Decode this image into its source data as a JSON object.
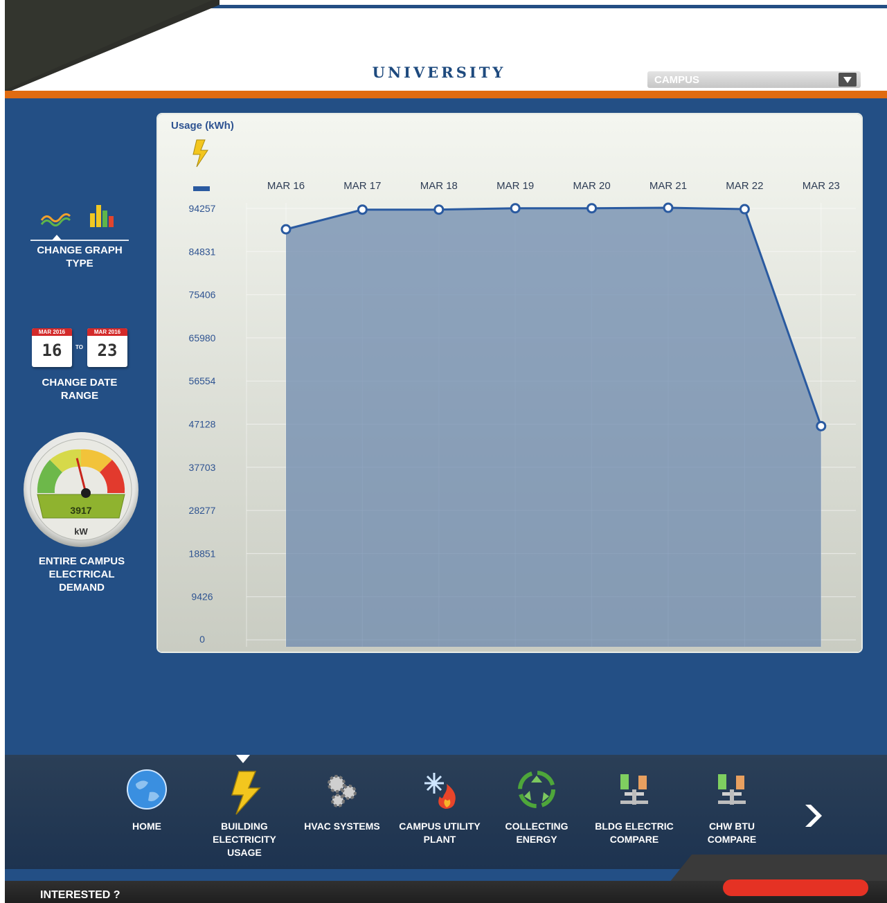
{
  "header": {
    "title": "UNIVERSITY",
    "selector_value": "CAMPUS"
  },
  "sidebar": {
    "graph_type_label_1": "CHANGE GRAPH",
    "graph_type_label_2": "TYPE",
    "date_from_month": "MAR 2016",
    "date_from_day": "16",
    "date_to_word": "TO",
    "date_to_month": "MAR 2016",
    "date_to_day": "23",
    "date_label_1": "CHANGE DATE",
    "date_label_2": "RANGE",
    "gauge_value": "3917",
    "gauge_unit": "kW",
    "gauge_level": 0.42,
    "demand_label_1": "ENTIRE CAMPUS",
    "demand_label_2": "ELECTRICAL",
    "demand_label_3": "DEMAND"
  },
  "chart_data": {
    "type": "area",
    "title": "Usage (kWh)",
    "categories": [
      "MAR 16",
      "MAR 17",
      "MAR 18",
      "MAR 19",
      "MAR 20",
      "MAR 21",
      "MAR 22",
      "MAR 23"
    ],
    "values": [
      89700,
      94000,
      94000,
      94300,
      94300,
      94400,
      94100,
      46700
    ],
    "ylim": [
      0,
      94257
    ],
    "yticks": [
      0,
      9426,
      18851,
      28277,
      37703,
      47128,
      56554,
      65980,
      75406,
      84831,
      94257
    ],
    "colors": {
      "line": "#2a5aa0",
      "fill": "#6e8aae",
      "marker": "#ffffff"
    },
    "grid": true
  },
  "nav": {
    "items": [
      {
        "label_1": "HOME",
        "label_2": "",
        "label_3": ""
      },
      {
        "label_1": "BUILDING",
        "label_2": "ELECTRICITY",
        "label_3": "USAGE"
      },
      {
        "label_1": "HVAC SYSTEMS",
        "label_2": "",
        "label_3": ""
      },
      {
        "label_1": "CAMPUS UTILITY",
        "label_2": "PLANT",
        "label_3": ""
      },
      {
        "label_1": "COLLECTING",
        "label_2": "ENERGY",
        "label_3": ""
      },
      {
        "label_1": "BLDG ELECTRIC",
        "label_2": "COMPARE",
        "label_3": ""
      },
      {
        "label_1": "CHW BTU",
        "label_2": "COMPARE",
        "label_3": ""
      }
    ],
    "active_index": 1,
    "icons": [
      "globe-icon",
      "lightning-icon",
      "gears-icon",
      "snowflake-fire-icon",
      "recycle-icon",
      "compare-bars-icon",
      "compare-bars-icon"
    ]
  },
  "footer": {
    "text": "INTERESTED ?"
  }
}
